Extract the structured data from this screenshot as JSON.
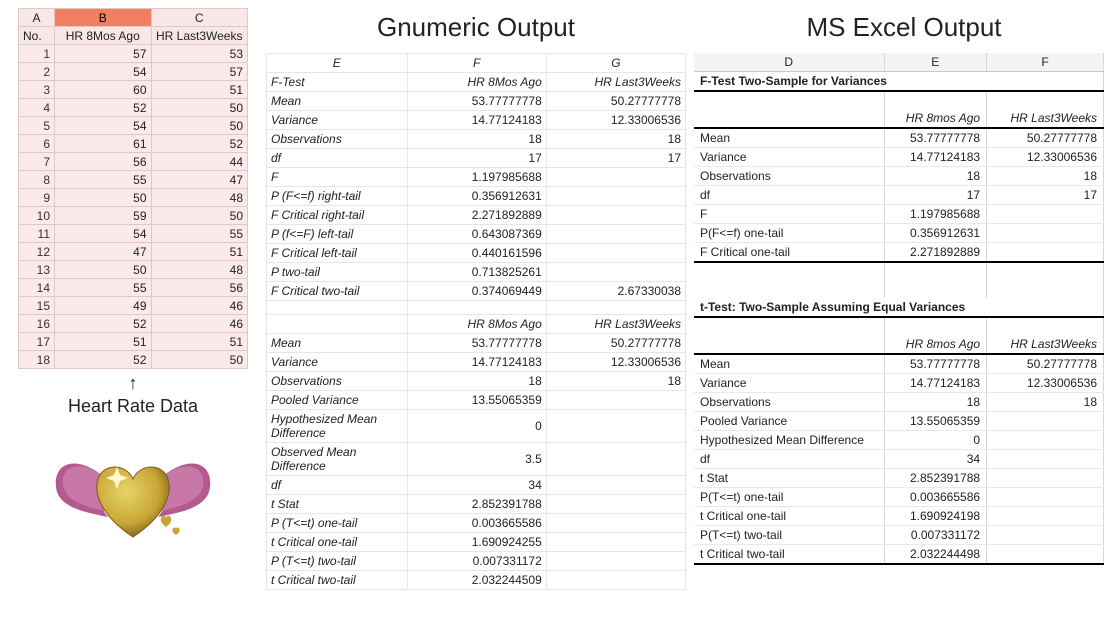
{
  "left_panel": {
    "cols": {
      "A": "A",
      "B": "B",
      "C": "C"
    },
    "headers": {
      "A": "No.",
      "B": "HR 8Mos Ago",
      "C": "HR Last3Weeks"
    },
    "rows": [
      {
        "n": "1",
        "b": "57",
        "c": "53"
      },
      {
        "n": "2",
        "b": "54",
        "c": "57"
      },
      {
        "n": "3",
        "b": "60",
        "c": "51"
      },
      {
        "n": "4",
        "b": "52",
        "c": "50"
      },
      {
        "n": "5",
        "b": "54",
        "c": "50"
      },
      {
        "n": "6",
        "b": "61",
        "c": "52"
      },
      {
        "n": "7",
        "b": "56",
        "c": "44"
      },
      {
        "n": "8",
        "b": "55",
        "c": "47"
      },
      {
        "n": "9",
        "b": "50",
        "c": "48"
      },
      {
        "n": "10",
        "b": "59",
        "c": "50"
      },
      {
        "n": "11",
        "b": "54",
        "c": "55"
      },
      {
        "n": "12",
        "b": "47",
        "c": "51"
      },
      {
        "n": "13",
        "b": "50",
        "c": "48"
      },
      {
        "n": "14",
        "b": "55",
        "c": "56"
      },
      {
        "n": "15",
        "b": "49",
        "c": "46"
      },
      {
        "n": "16",
        "b": "52",
        "c": "46"
      },
      {
        "n": "17",
        "b": "51",
        "c": "51"
      },
      {
        "n": "18",
        "b": "52",
        "c": "50"
      }
    ],
    "arrow": "↑",
    "caption": "Heart Rate Data"
  },
  "gnumeric": {
    "title": "Gnumeric Output",
    "cols": {
      "E": "E",
      "F": "F",
      "G": "G"
    },
    "ftest": {
      "header": {
        "label": "F-Test",
        "c1": "HR 8Mos Ago",
        "c2": "HR Last3Weeks"
      },
      "rows": [
        {
          "label": "Mean",
          "c1": "53.77777778",
          "c2": "50.27777778"
        },
        {
          "label": "Variance",
          "c1": "14.77124183",
          "c2": "12.33006536"
        },
        {
          "label": "Observations",
          "c1": "18",
          "c2": "18"
        },
        {
          "label": "df",
          "c1": "17",
          "c2": "17"
        },
        {
          "label": "F",
          "c1": "1.197985688",
          "c2": ""
        },
        {
          "label": "P (F<=f) right-tail",
          "c1": "0.356912631",
          "c2": ""
        },
        {
          "label": "F Critical right-tail",
          "c1": "2.271892889",
          "c2": ""
        },
        {
          "label": "P (f<=F) left-tail",
          "c1": "0.643087369",
          "c2": ""
        },
        {
          "label": "F Critical left-tail",
          "c1": "0.440161596",
          "c2": ""
        },
        {
          "label": "P two-tail",
          "c1": "0.713825261",
          "c2": ""
        },
        {
          "label": "F Critical two-tail",
          "c1": "0.374069449",
          "c2": "2.67330038"
        }
      ]
    },
    "ttest": {
      "header": {
        "label": "",
        "c1": "HR 8Mos Ago",
        "c2": "HR Last3Weeks"
      },
      "rows": [
        {
          "label": "Mean",
          "c1": "53.77777778",
          "c2": "50.27777778"
        },
        {
          "label": "Variance",
          "c1": "14.77124183",
          "c2": "12.33006536"
        },
        {
          "label": "Observations",
          "c1": "18",
          "c2": "18"
        },
        {
          "label": "Pooled Variance",
          "c1": "13.55065359",
          "c2": ""
        },
        {
          "label": "Hypothesized Mean Difference",
          "c1": "0",
          "c2": ""
        },
        {
          "label": "Observed Mean Difference",
          "c1": "3.5",
          "c2": ""
        },
        {
          "label": "df",
          "c1": "34",
          "c2": ""
        },
        {
          "label": "t Stat",
          "c1": "2.852391788",
          "c2": ""
        },
        {
          "label": "P (T<=t) one-tail",
          "c1": "0.003665586",
          "c2": ""
        },
        {
          "label": "t Critical one-tail",
          "c1": "1.690924255",
          "c2": ""
        },
        {
          "label": "P (T<=t) two-tail",
          "c1": "0.007331172",
          "c2": ""
        },
        {
          "label": "t Critical two-tail",
          "c1": "2.032244509",
          "c2": ""
        }
      ]
    }
  },
  "excel": {
    "title": "MS Excel Output",
    "cols": {
      "D": "D",
      "E": "E",
      "F": "F"
    },
    "ftest": {
      "section_title": "F-Test Two-Sample for Variances",
      "colhdr": {
        "c1": "HR 8mos Ago",
        "c2": "HR Last3Weeks"
      },
      "rows": [
        {
          "label": "Mean",
          "c1": "53.77777778",
          "c2": "50.27777778"
        },
        {
          "label": "Variance",
          "c1": "14.77124183",
          "c2": "12.33006536"
        },
        {
          "label": "Observations",
          "c1": "18",
          "c2": "18"
        },
        {
          "label": "df",
          "c1": "17",
          "c2": "17"
        },
        {
          "label": "F",
          "c1": "1.197985688",
          "c2": ""
        },
        {
          "label": "P(F<=f) one-tail",
          "c1": "0.356912631",
          "c2": ""
        },
        {
          "label": "F Critical one-tail",
          "c1": "2.271892889",
          "c2": ""
        }
      ]
    },
    "ttest": {
      "section_title": "t-Test: Two-Sample Assuming Equal Variances",
      "colhdr": {
        "c1": "HR 8mos Ago",
        "c2": "HR Last3Weeks"
      },
      "rows": [
        {
          "label": "Mean",
          "c1": "53.77777778",
          "c2": "50.27777778"
        },
        {
          "label": "Variance",
          "c1": "14.77124183",
          "c2": "12.33006536"
        },
        {
          "label": "Observations",
          "c1": "18",
          "c2": "18"
        },
        {
          "label": "Pooled Variance",
          "c1": "13.55065359",
          "c2": ""
        },
        {
          "label": "Hypothesized Mean Difference",
          "c1": "0",
          "c2": ""
        },
        {
          "label": "df",
          "c1": "34",
          "c2": ""
        },
        {
          "label": "t Stat",
          "c1": "2.852391788",
          "c2": ""
        },
        {
          "label": "P(T<=t) one-tail",
          "c1": "0.003665586",
          "c2": ""
        },
        {
          "label": "t Critical one-tail",
          "c1": "1.690924198",
          "c2": ""
        },
        {
          "label": "P(T<=t) two-tail",
          "c1": "0.007331172",
          "c2": ""
        },
        {
          "label": "t Critical two-tail",
          "c1": "2.032244498",
          "c2": ""
        }
      ]
    }
  }
}
